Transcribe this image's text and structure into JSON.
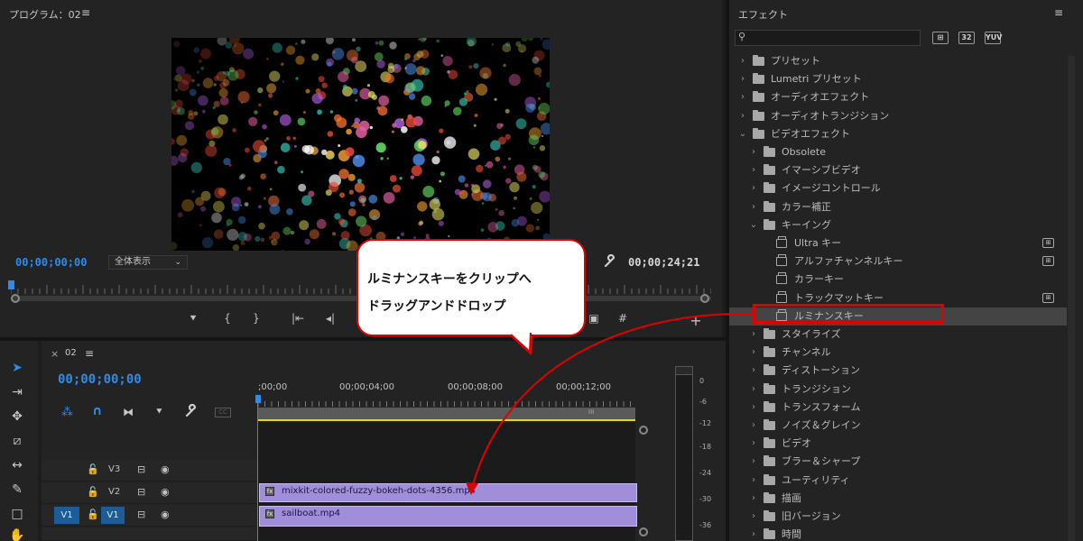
{
  "program": {
    "title": "プログラム：02",
    "menu": "≡",
    "timecode_current": "00;00;00;00",
    "fit_label": "全体表示",
    "timecode_duration": "00;00;24;21"
  },
  "effects": {
    "title": "エフェクト",
    "menu": "≡",
    "filters": [
      "⊞",
      "32",
      "YUV"
    ],
    "tree": [
      {
        "label": "プリセット",
        "level": 0,
        "type": "preset-folder",
        "open": false
      },
      {
        "label": "Lumetri プリセット",
        "level": 0,
        "type": "preset-folder",
        "open": false
      },
      {
        "label": "オーディオエフェクト",
        "level": 0,
        "type": "folder",
        "open": false
      },
      {
        "label": "オーディオトランジション",
        "level": 0,
        "type": "folder",
        "open": false
      },
      {
        "label": "ビデオエフェクト",
        "level": 0,
        "type": "folder",
        "open": true
      },
      {
        "label": "Obsolete",
        "level": 1,
        "type": "folder",
        "open": false
      },
      {
        "label": "イマーシブビデオ",
        "level": 1,
        "type": "folder",
        "open": false
      },
      {
        "label": "イメージコントロール",
        "level": 1,
        "type": "folder",
        "open": false
      },
      {
        "label": "カラー補正",
        "level": 1,
        "type": "folder",
        "open": false
      },
      {
        "label": "キーイング",
        "level": 1,
        "type": "folder",
        "open": true
      },
      {
        "label": "Ultra キー",
        "level": 2,
        "type": "effect",
        "badge": true
      },
      {
        "label": "アルファチャンネルキー",
        "level": 2,
        "type": "effect",
        "badge": true
      },
      {
        "label": "カラーキー",
        "level": 2,
        "type": "effect",
        "badge": false
      },
      {
        "label": "トラックマットキー",
        "level": 2,
        "type": "effect",
        "badge": true
      },
      {
        "label": "ルミナンスキー",
        "level": 2,
        "type": "effect",
        "badge": false,
        "selected": true
      },
      {
        "label": "スタイライズ",
        "level": 1,
        "type": "folder",
        "open": false
      },
      {
        "label": "チャンネル",
        "level": 1,
        "type": "folder",
        "open": false
      },
      {
        "label": "ディストーション",
        "level": 1,
        "type": "folder",
        "open": false
      },
      {
        "label": "トランジション",
        "level": 1,
        "type": "folder",
        "open": false
      },
      {
        "label": "トランスフォーム",
        "level": 1,
        "type": "folder",
        "open": false
      },
      {
        "label": "ノイズ＆グレイン",
        "level": 1,
        "type": "folder",
        "open": false
      },
      {
        "label": "ビデオ",
        "level": 1,
        "type": "folder",
        "open": false
      },
      {
        "label": "ブラー＆シャープ",
        "level": 1,
        "type": "folder",
        "open": false
      },
      {
        "label": "ユーティリティ",
        "level": 1,
        "type": "folder",
        "open": false
      },
      {
        "label": "描画",
        "level": 1,
        "type": "folder",
        "open": false
      },
      {
        "label": "旧バージョン",
        "level": 1,
        "type": "folder",
        "open": false
      },
      {
        "label": "時間",
        "level": 1,
        "type": "folder",
        "open": false
      }
    ]
  },
  "timeline": {
    "close": "×",
    "sequence_name": "02",
    "menu": "≡",
    "timecode": "00;00;00;00",
    "ruler_labels": [
      ";00;00",
      "00;00;04;00",
      "00;00;08;00",
      "00;00;12;00"
    ],
    "work_marker": "III",
    "tracks": [
      {
        "name": "V3"
      },
      {
        "name": "V2"
      },
      {
        "name": "V1",
        "source": "V1"
      }
    ],
    "clips": [
      {
        "name": "mixkit-colored-fuzzy-bokeh-dots-4356.mp4",
        "fx": "fx"
      },
      {
        "name": "sailboat.mp4",
        "fx": "fx"
      }
    ]
  },
  "meter": {
    "db_labels": [
      "0",
      "-6",
      "-12",
      "-18",
      "-24",
      "-30",
      "-36"
    ]
  },
  "callout": {
    "line1": "ルミナンスキーをクリップへ",
    "line2": "ドラッグアンドドロップ"
  },
  "colors": {
    "accent_blue": "#2d8ceb",
    "annotation_red": "#e00000",
    "clip_purple": "#a18edb",
    "work_yellow": "#e8d800"
  }
}
